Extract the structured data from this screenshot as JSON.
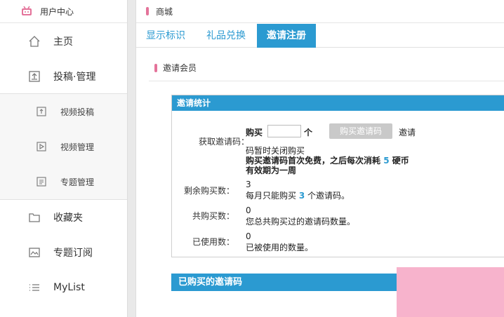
{
  "sidebar": {
    "header": "用户中心",
    "items": [
      {
        "label": "主页",
        "icon": "home-icon"
      },
      {
        "label": "投稿·管理",
        "icon": "upload-icon"
      },
      {
        "label": "视频投稿",
        "icon": "video-upload-icon"
      },
      {
        "label": "视频管理",
        "icon": "video-manage-icon"
      },
      {
        "label": "专题管理",
        "icon": "topic-manage-icon"
      },
      {
        "label": "收藏夹",
        "icon": "folder-icon"
      },
      {
        "label": "专题订阅",
        "icon": "subscribe-icon"
      },
      {
        "label": "MyList",
        "icon": "list-icon"
      }
    ]
  },
  "main": {
    "header": "商城",
    "tabs": [
      {
        "label": "显示标识"
      },
      {
        "label": "礼品兑换"
      },
      {
        "label": "邀请注册"
      }
    ],
    "section_title": "邀请会员",
    "panel": {
      "title": "邀请统计",
      "get_code_label": "获取邀请码：",
      "buy_prefix": "购买",
      "buy_unit": "个",
      "buy_button": "购买邀请码",
      "invite_text": "邀请",
      "notice_line1": "码暂时关闭购买",
      "notice_line2_a": "购买邀请码首次免费，之后每次消耗 ",
      "notice_cost": "5",
      "notice_line2_b": " 硬币",
      "notice_validity": "有效期为一周",
      "remaining_label": "剩余购买数：",
      "remaining_value": "3",
      "remaining_desc_a": "每月只能购买 ",
      "remaining_desc_num": "3",
      "remaining_desc_b": " 个邀请码。",
      "total_label": "共购买数：",
      "total_value": "0",
      "total_desc": "您总共购买过的邀请码数量。",
      "used_label": "已使用数：",
      "used_value": "0",
      "used_desc": "已被使用的数量。"
    },
    "purchased_title": "已购买的邀请码"
  },
  "colors": {
    "accent": "#2b9ad1",
    "pink": "#e4739a",
    "overlay": "#f7b3cc"
  }
}
